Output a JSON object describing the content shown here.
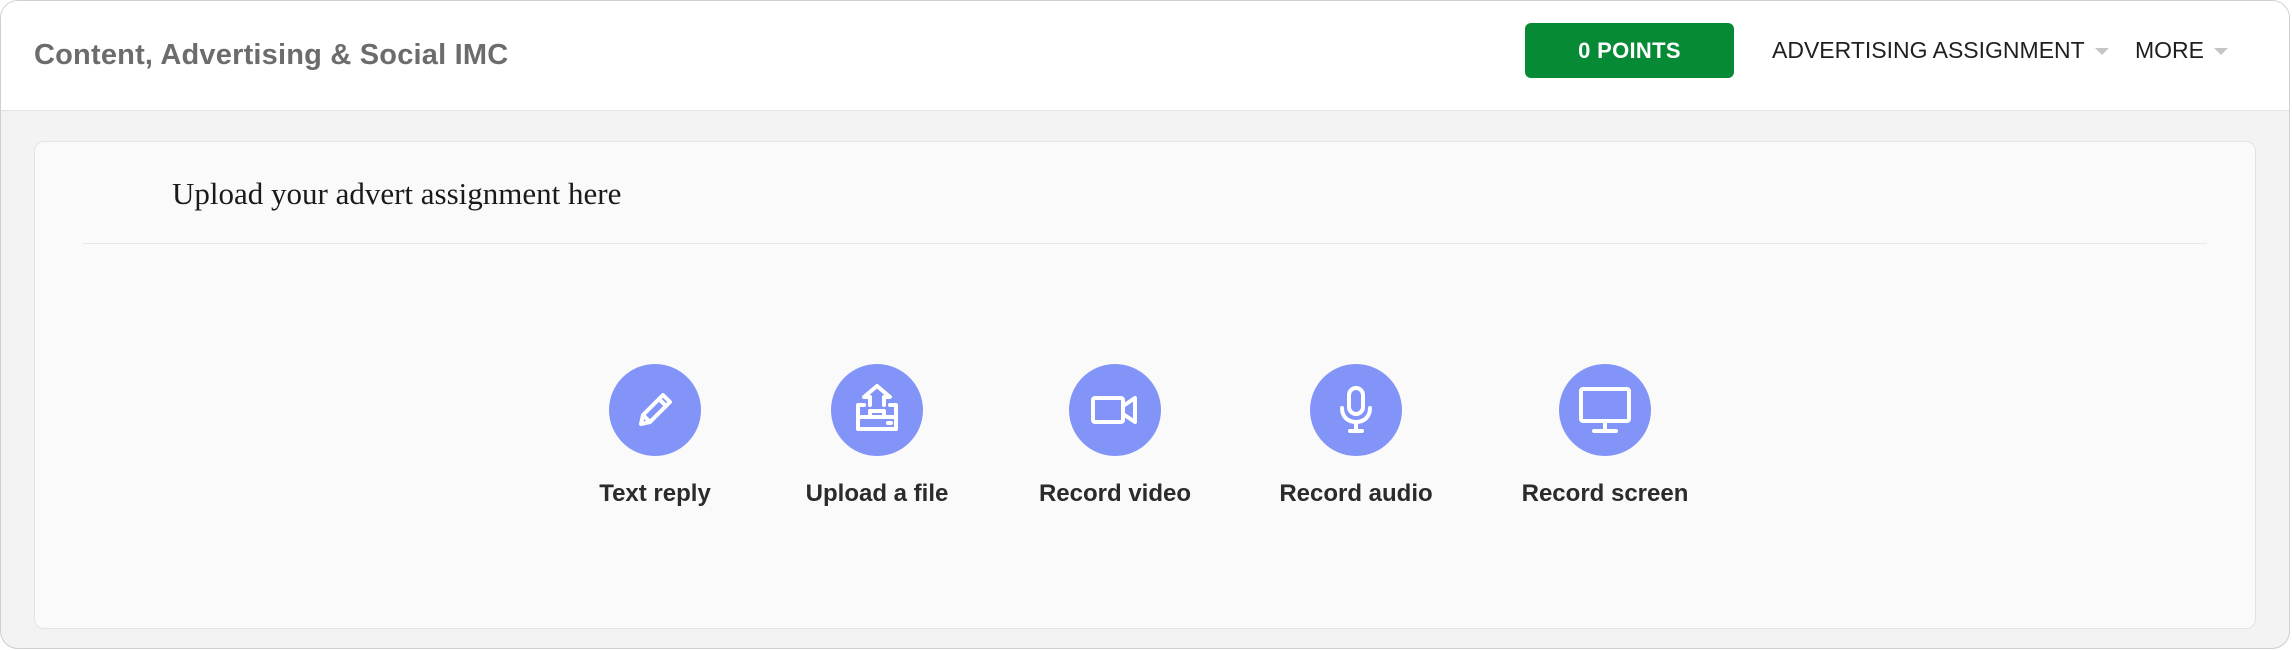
{
  "header": {
    "course_title": "Content, Advertising & Social IMC",
    "points_label": "0 POINTS",
    "points_color": "#078a36",
    "nav": [
      {
        "label": "ADVERTISING ASSIGNMENT",
        "icon": "caret-down-icon"
      },
      {
        "label": "MORE",
        "icon": "caret-down-icon"
      }
    ]
  },
  "assignment": {
    "heading": "Upload your advert assignment here",
    "accent_color": "#8394f8",
    "options": [
      {
        "label": "Text reply",
        "icon": "pencil-icon"
      },
      {
        "label": "Upload a file",
        "icon": "upload-tray-icon"
      },
      {
        "label": "Record video",
        "icon": "video-camera-icon"
      },
      {
        "label": "Record audio",
        "icon": "microphone-icon"
      },
      {
        "label": "Record screen",
        "icon": "monitor-icon"
      }
    ]
  }
}
